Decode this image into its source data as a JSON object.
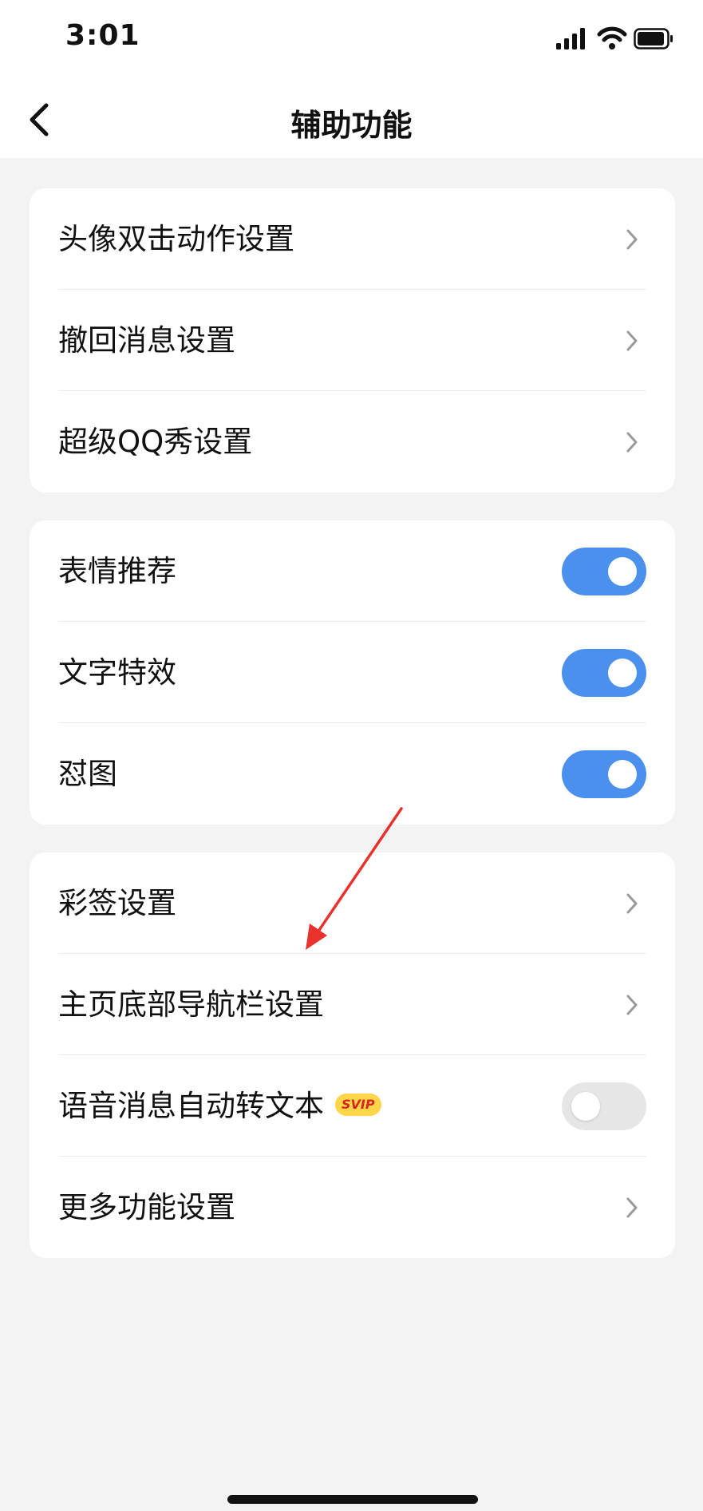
{
  "status_bar": {
    "time": "3:01"
  },
  "nav": {
    "title": "辅助功能"
  },
  "sections": [
    {
      "items": [
        {
          "label": "头像双击动作设置",
          "control": "chevron"
        },
        {
          "label": "撤回消息设置",
          "control": "chevron"
        },
        {
          "label": "超级QQ秀设置",
          "control": "chevron"
        }
      ]
    },
    {
      "items": [
        {
          "label": "表情推荐",
          "control": "toggle",
          "on": true
        },
        {
          "label": "文字特效",
          "control": "toggle",
          "on": true
        },
        {
          "label": "怼图",
          "control": "toggle",
          "on": true
        }
      ]
    },
    {
      "items": [
        {
          "label": "彩签设置",
          "control": "chevron"
        },
        {
          "label": "主页底部导航栏设置",
          "control": "chevron"
        },
        {
          "label": "语音消息自动转文本",
          "badge": "SVIP",
          "control": "toggle",
          "on": false
        },
        {
          "label": "更多功能设置",
          "control": "chevron"
        }
      ]
    }
  ],
  "colors": {
    "toggle_on": "#4a90ec",
    "toggle_off": "#e6e6e6",
    "badge_bg": "#ffd54a",
    "badge_text": "#d7261d",
    "annotation_arrow": "#e8322b"
  },
  "icons": [
    "back-arrow-icon",
    "chevron-right-icon",
    "signal-icon",
    "wifi-icon",
    "battery-icon"
  ]
}
